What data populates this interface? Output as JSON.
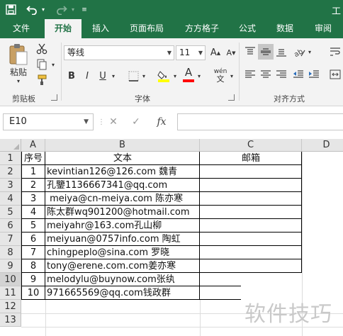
{
  "title_bar": {
    "title": "工"
  },
  "tabs": [
    "文件",
    "开始",
    "插入",
    "页面布局",
    "方方格子",
    "公式",
    "数据",
    "审阅"
  ],
  "ribbon": {
    "clipboard": {
      "paste": "粘贴",
      "group": "剪贴板"
    },
    "font": {
      "name": "等线",
      "size": "11",
      "group": "字体",
      "bold": "B",
      "italic": "I",
      "underline": "U",
      "font_color_glyph": "A",
      "phonetic": "wén"
    },
    "alignment": {
      "group": "对齐方式"
    }
  },
  "formula_bar": {
    "name_box": "E10",
    "fx": "fx",
    "value": ""
  },
  "sheet": {
    "columns": [
      "A",
      "B",
      "C",
      "D"
    ],
    "rows": [
      "1",
      "2",
      "3",
      "4",
      "5",
      "6",
      "7",
      "8",
      "9",
      "10",
      "11",
      "12",
      "13"
    ],
    "header_row": {
      "a": "序号",
      "b": "文本",
      "c": "邮箱"
    },
    "data": [
      {
        "n": "1",
        "text": "kevintian126@126.com 魏青"
      },
      {
        "n": "2",
        "text": "孔鑒1136667341@qq.com"
      },
      {
        "n": "3",
        "text": " meiya@cn-meiya.com 陈亦寒"
      },
      {
        "n": "4",
        "text": "陈太群wq901200@hotmail.com"
      },
      {
        "n": "5",
        "text": "meiyahr@163.com孔山柳"
      },
      {
        "n": "6",
        "text": "meiyuan@0757info.com 陶虹"
      },
      {
        "n": "7",
        "text": "chingpeplo@sina.com 罗晓"
      },
      {
        "n": "8",
        "text": "tony@erene.com.com姜亦寒"
      },
      {
        "n": "9",
        "text": "melodylu@buynow.com张纨"
      },
      {
        "n": "10",
        "text": "971665569@qq.com钱政群"
      }
    ],
    "active_cell": "E10"
  },
  "watermark": "软件技巧",
  "colors": {
    "brand": "#217346",
    "fill_yellow": "#ffff00",
    "font_red": "#ff0000"
  }
}
